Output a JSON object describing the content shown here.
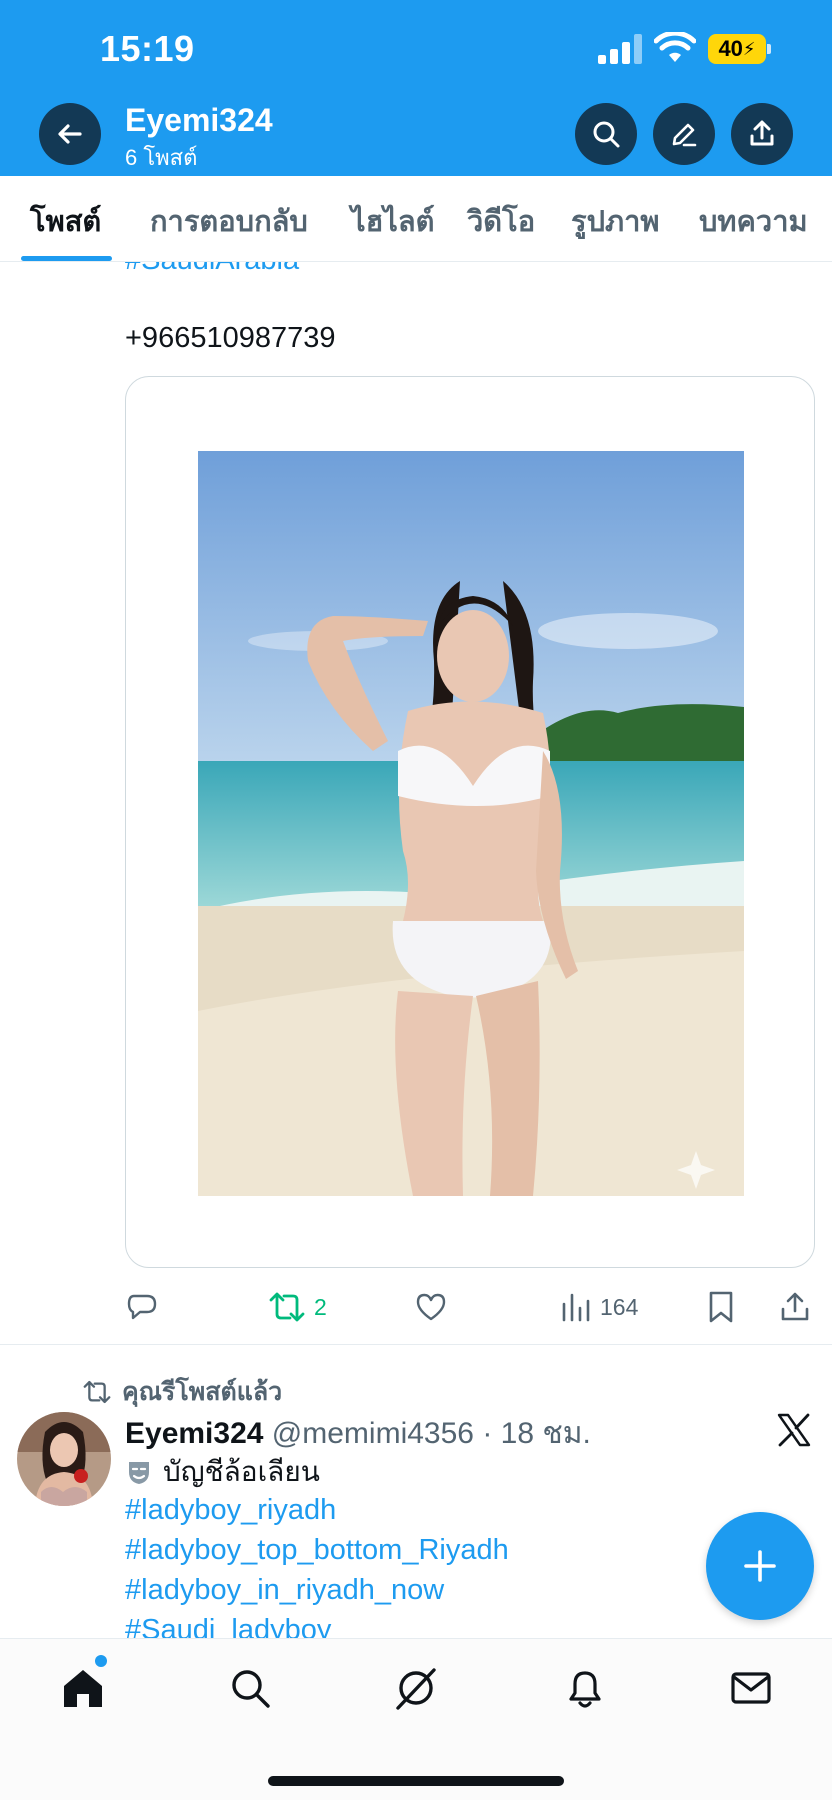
{
  "status_bar": {
    "time": "15:19",
    "battery": "40"
  },
  "header": {
    "name": "Eyemi324",
    "post_count": "6 โพสต์"
  },
  "tabs": [
    {
      "label": "โพสต์",
      "active": true
    },
    {
      "label": "การตอบกลับ",
      "active": false
    },
    {
      "label": "ไฮไลต์",
      "active": false
    },
    {
      "label": "วิดีโอ",
      "active": false
    },
    {
      "label": "รูปภาพ",
      "active": false
    },
    {
      "label": "บทความ",
      "active": false
    }
  ],
  "post1": {
    "hashtag_cut": "#SaudiArabia",
    "phone": "+966510987739",
    "actions": {
      "retweets": "2",
      "views": "164"
    }
  },
  "post2": {
    "repost_label": "คุณรีโพสต์แล้ว",
    "name": "Eyemi324",
    "handle": "@memimi4356",
    "separator": "·",
    "time": "18 ชม.",
    "parody_label": "บัญชีล้อเลียน",
    "hashtags": [
      "#ladyboy_riyadh",
      "#ladyboy_top_bottom_Riyadh",
      "#ladyboy_in_riyadh_now",
      "#Saudi_ladyboy"
    ]
  },
  "colors": {
    "brand": "#1d9bf0",
    "retweet": "#00ba7c",
    "text": "#0f1419",
    "muted": "#536471"
  },
  "icons": {
    "header": [
      "back-arrow-icon",
      "search-icon",
      "edit-icon",
      "share-icon"
    ],
    "actions": [
      "reply-icon",
      "retweet-icon",
      "like-icon",
      "views-icon",
      "bookmark-icon",
      "share-icon"
    ],
    "nav": [
      "home-icon",
      "search-icon",
      "grok-icon",
      "notifications-icon",
      "messages-icon"
    ],
    "fab": "plus-icon"
  }
}
